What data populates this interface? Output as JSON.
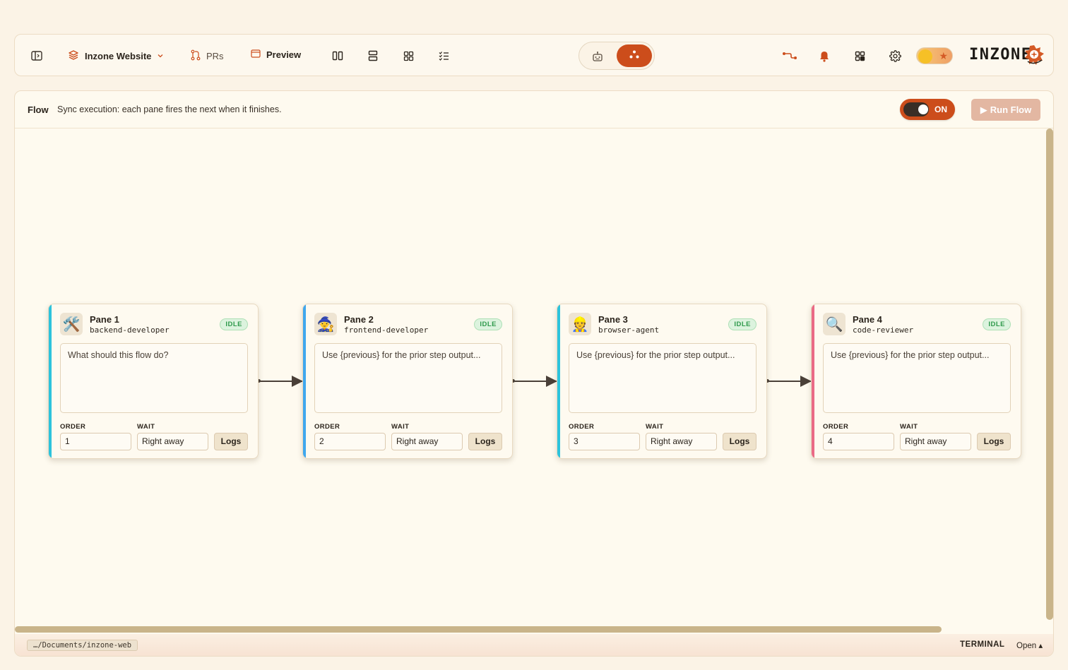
{
  "topbar": {
    "project_name": "Inzone Website",
    "prs_label": "PRs",
    "preview_label": "Preview",
    "brand": "INZONE"
  },
  "flow": {
    "title": "Flow",
    "description": "Sync execution: each pane fires the next when it finishes.",
    "toggle_label": "ON",
    "run_label": "Run Flow"
  },
  "panes": [
    {
      "title": "Pane 1",
      "role": "backend-developer",
      "status": "IDLE",
      "avatar": "🛠️",
      "placeholder": "What should this flow do?",
      "order_label": "ORDER",
      "wait_label": "WAIT",
      "order": "1",
      "wait": "Right away",
      "logs_label": "Logs",
      "accent": "#2cc3dc"
    },
    {
      "title": "Pane 2",
      "role": "frontend-developer",
      "status": "IDLE",
      "avatar": "🧙",
      "placeholder": "Use {previous} for the prior step output...",
      "order_label": "ORDER",
      "wait_label": "WAIT",
      "order": "2",
      "wait": "Right away",
      "logs_label": "Logs",
      "accent": "#3fa7ee"
    },
    {
      "title": "Pane 3",
      "role": "browser-agent",
      "status": "IDLE",
      "avatar": "👷",
      "placeholder": "Use {previous} for the prior step output...",
      "order_label": "ORDER",
      "wait_label": "WAIT",
      "order": "3",
      "wait": "Right away",
      "logs_label": "Logs",
      "accent": "#2cc3dc"
    },
    {
      "title": "Pane 4",
      "role": "code-reviewer",
      "status": "IDLE",
      "avatar": "🔍",
      "placeholder": "Use {previous} for the prior step output...",
      "order_label": "ORDER",
      "wait_label": "WAIT",
      "order": "4",
      "wait": "Right away",
      "logs_label": "Logs",
      "accent": "#ea6a86"
    }
  ],
  "footer": {
    "path": "…/Documents/inzone-web",
    "terminal_label": "TERMINAL",
    "open_label": "Open ▴"
  },
  "colors": {
    "accent": "#cc4d1b",
    "status_idle": "#2f9a4c"
  }
}
